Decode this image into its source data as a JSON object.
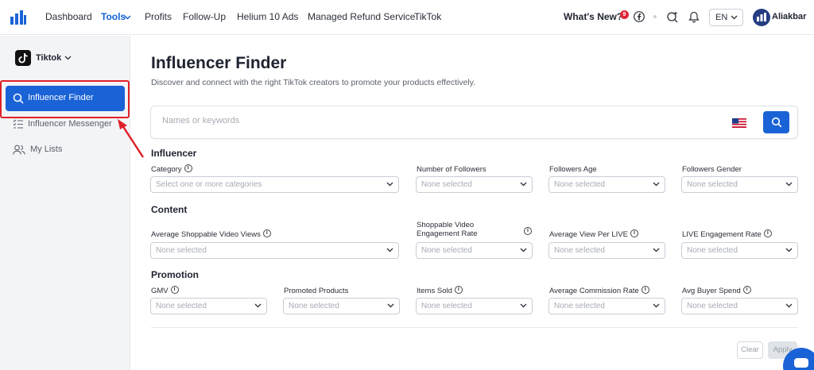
{
  "topnav": {
    "items": [
      "Dashboard",
      "Tools",
      "Profits",
      "Follow-Up",
      "Helium 10 Ads",
      "Managed Refund Service",
      "TikTok"
    ],
    "active": "Tools",
    "whats_new": "What's New?",
    "notif_count": "9",
    "language": "EN",
    "username": "Aliakbar"
  },
  "sidebar": {
    "platform": "Tiktok",
    "items": [
      {
        "label": "Influencer Finder",
        "icon": "search-icon",
        "active": true
      },
      {
        "label": "Influencer Messenger",
        "icon": "checklist-icon",
        "active": false
      },
      {
        "label": "My Lists",
        "icon": "users-icon",
        "active": false
      }
    ]
  },
  "main": {
    "title": "Influencer Finder",
    "subtitle": "Discover and connect with the right TikTok creators to promote your products effectively.",
    "search": {
      "placeholder": "Names or keywords",
      "value": ""
    },
    "sections": {
      "influencer": {
        "title": "Influencer",
        "filters": [
          {
            "label": "Category",
            "value": "Select one or more categories"
          },
          {
            "label": "Number of Followers",
            "value": "None selected"
          },
          {
            "label": "Followers Age",
            "value": "None selected"
          },
          {
            "label": "Followers Gender",
            "value": "None selected"
          }
        ]
      },
      "content": {
        "title": "Content",
        "filters": [
          {
            "label": "Average Shoppable Video Views",
            "value": "None selected"
          },
          {
            "label": "Shoppable Video Engagement Rate",
            "value": "None selected"
          },
          {
            "label": "Average View Per LIVE",
            "value": "None selected"
          },
          {
            "label": "LIVE Engagement Rate",
            "value": "None selected"
          }
        ]
      },
      "promotion": {
        "title": "Promotion",
        "filters": [
          {
            "label": "GMV",
            "value": "None selected"
          },
          {
            "label": "Promoted Products",
            "value": "None selected"
          },
          {
            "label": "Items Sold",
            "value": "None selected"
          },
          {
            "label": "Average Commission Rate",
            "value": "None selected"
          },
          {
            "label": "Avg Buyer Spend",
            "value": "None selected"
          }
        ]
      }
    },
    "buttons": {
      "clear": "Clear",
      "apply": "Apply"
    }
  },
  "colors": {
    "accent": "#1a63d6",
    "highlight": "#e0202a"
  }
}
